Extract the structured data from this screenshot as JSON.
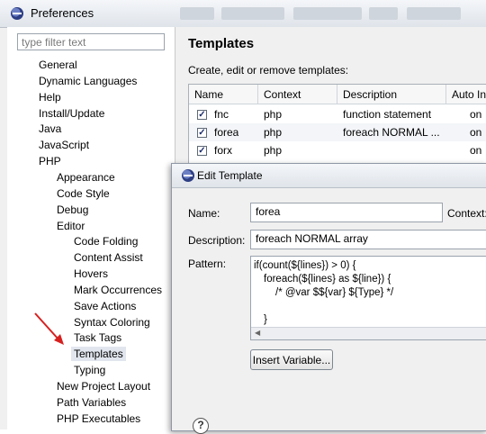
{
  "window": {
    "title": "Preferences"
  },
  "filter": {
    "placeholder": "type filter text"
  },
  "tree": [
    {
      "label": "General",
      "level": 0
    },
    {
      "label": "Dynamic Languages",
      "level": 0
    },
    {
      "label": "Help",
      "level": 0
    },
    {
      "label": "Install/Update",
      "level": 0
    },
    {
      "label": "Java",
      "level": 0
    },
    {
      "label": "JavaScript",
      "level": 0
    },
    {
      "label": "PHP",
      "level": 0
    },
    {
      "label": "Appearance",
      "level": 1
    },
    {
      "label": "Code Style",
      "level": 1
    },
    {
      "label": "Debug",
      "level": 1
    },
    {
      "label": "Editor",
      "level": 1
    },
    {
      "label": "Code Folding",
      "level": 2
    },
    {
      "label": "Content Assist",
      "level": 2
    },
    {
      "label": "Hovers",
      "level": 2
    },
    {
      "label": "Mark Occurrences",
      "level": 2
    },
    {
      "label": "Save Actions",
      "level": 2
    },
    {
      "label": "Syntax Coloring",
      "level": 2
    },
    {
      "label": "Task Tags",
      "level": 2
    },
    {
      "label": "Templates",
      "level": 2,
      "selected": true
    },
    {
      "label": "Typing",
      "level": 2
    },
    {
      "label": "New Project Layout",
      "level": 1
    },
    {
      "label": "Path Variables",
      "level": 1
    },
    {
      "label": "PHP Executables",
      "level": 1
    }
  ],
  "templates_page": {
    "title": "Templates",
    "description": "Create, edit or remove templates:",
    "columns": [
      "Name",
      "Context",
      "Description",
      "Auto In"
    ],
    "rows": [
      {
        "checked": true,
        "name": "fnc",
        "context": "php",
        "description": "function statement",
        "auto": "on"
      },
      {
        "checked": true,
        "name": "forea",
        "context": "php",
        "description": "foreach NORMAL ...",
        "auto": "on"
      },
      {
        "checked": true,
        "name": "forx",
        "context": "php",
        "description": "",
        "auto": "on"
      }
    ]
  },
  "edit_dialog": {
    "title": "Edit Template",
    "name_label": "Name:",
    "name_value": "forea",
    "context_label": "Context:",
    "description_label": "Description:",
    "description_value": "foreach NORMAL array",
    "pattern_label": "Pattern:",
    "pattern_lines": [
      "if(count(${lines}) > 0) {",
      "foreach(${lines} as ${line}) {",
      "/* @var $${var} ${Type} */",
      "",
      "}"
    ],
    "insert_button": "Insert Variable...",
    "help_icon": "?"
  },
  "annotation": {
    "arrow_color": "#d62020"
  }
}
